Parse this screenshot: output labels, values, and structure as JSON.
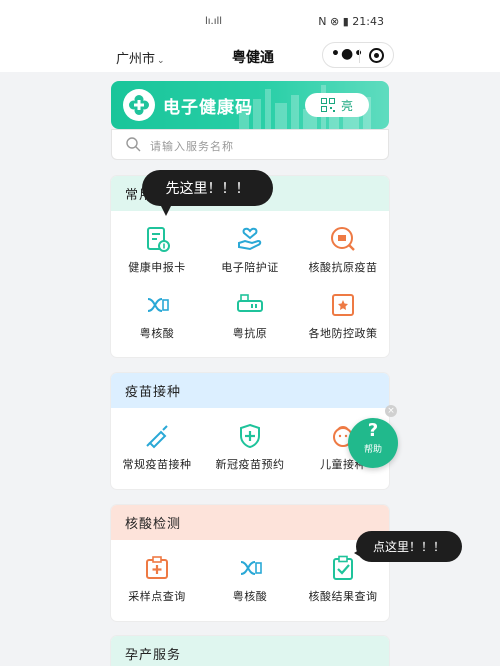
{
  "status_bar": {
    "center_text": "lı.ıll",
    "time": "21:43",
    "battery": "N ⊗ ▮"
  },
  "nav": {
    "city": "广州市",
    "title": "粤健通"
  },
  "banner": {
    "title": "电子健康码",
    "qr_label": "亮"
  },
  "search": {
    "placeholder": "请输入服务名称"
  },
  "sections": {
    "common": {
      "title": "常用服务",
      "items": [
        "健康申报卡",
        "电子陪护证",
        "核酸抗原疫苗",
        "粤核酸",
        "粤抗原",
        "各地防控政策"
      ]
    },
    "vaccine": {
      "title": "疫苗接种",
      "items": [
        "常规疫苗接种",
        "新冠疫苗预约",
        "儿童接种"
      ]
    },
    "nat": {
      "title": "核酸检测",
      "items": [
        "采样点查询",
        "粤核酸",
        "核酸结果查询"
      ]
    },
    "preg": {
      "title": "孕产服务"
    }
  },
  "bubbles": {
    "first": "先这里！！！",
    "second": "点这里！！！"
  },
  "help": {
    "icon": "?",
    "label": "帮助"
  },
  "colors": {
    "brand_green": "#1fc39b",
    "icon_blue": "#2aa8d6",
    "icon_orange": "#ee7a44"
  }
}
